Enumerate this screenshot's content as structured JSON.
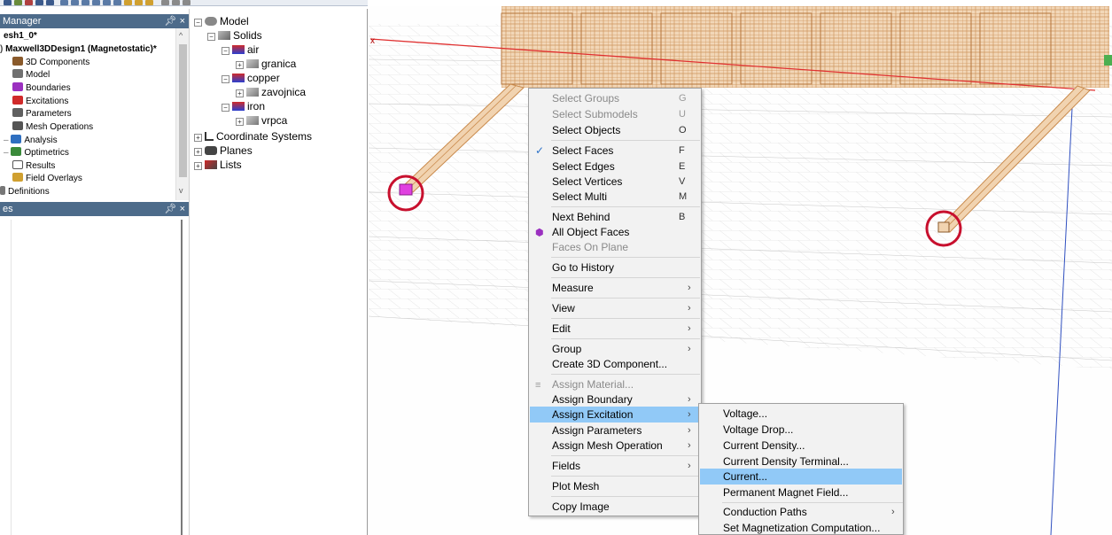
{
  "project_manager": {
    "title": "Manager",
    "items": [
      {
        "label": "esh1_0*",
        "icon": "project-icon"
      },
      {
        "label": "Maxwell3DDesign1 (Magnetostatic)*",
        "icon": "design-icon"
      },
      {
        "label": "3D Components",
        "icon": "components-icon"
      },
      {
        "label": "Model",
        "icon": "model-icon"
      },
      {
        "label": "Boundaries",
        "icon": "boundaries-icon"
      },
      {
        "label": "Excitations",
        "icon": "excitations-icon"
      },
      {
        "label": "Parameters",
        "icon": "parameters-icon"
      },
      {
        "label": "Mesh Operations",
        "icon": "mesh-icon"
      },
      {
        "label": "Analysis",
        "icon": "analysis-icon"
      },
      {
        "label": "Optimetrics",
        "icon": "optimetrics-icon"
      },
      {
        "label": "Results",
        "icon": "results-icon"
      },
      {
        "label": "Field Overlays",
        "icon": "field-overlays-icon"
      },
      {
        "label": "Definitions",
        "icon": "definitions-icon"
      }
    ]
  },
  "properties_panel": {
    "title": "es"
  },
  "model_tree": {
    "items": [
      {
        "label": "Model",
        "icon": "model-icon"
      },
      {
        "label": "Solids",
        "icon": "solids-icon"
      },
      {
        "label": "air",
        "icon": "material-icon"
      },
      {
        "label": "granica",
        "icon": "object-icon"
      },
      {
        "label": "copper",
        "icon": "material-icon"
      },
      {
        "label": "zavojnica",
        "icon": "object-icon"
      },
      {
        "label": "iron",
        "icon": "material-icon"
      },
      {
        "label": "vrpca",
        "icon": "object-icon"
      },
      {
        "label": "Coordinate Systems",
        "icon": "coordinate-icon"
      },
      {
        "label": "Planes",
        "icon": "planes-icon"
      },
      {
        "label": "Lists",
        "icon": "lists-icon"
      }
    ]
  },
  "viewport": {
    "axis_label": "x"
  },
  "context_menu": {
    "items": [
      {
        "label": "Select Groups",
        "key": "G"
      },
      {
        "label": "Select Submodels",
        "key": "U"
      },
      {
        "label": "Select Objects",
        "key": "O"
      },
      {
        "label": "Select Faces",
        "key": "F"
      },
      {
        "label": "Select Edges",
        "key": "E"
      },
      {
        "label": "Select Vertices",
        "key": "V"
      },
      {
        "label": "Select Multi",
        "key": "M"
      },
      {
        "label": "Next Behind",
        "key": "B"
      },
      {
        "label": "All Object Faces"
      },
      {
        "label": "Faces On Plane"
      },
      {
        "label": "Go to History"
      },
      {
        "label": "Measure"
      },
      {
        "label": "View"
      },
      {
        "label": "Edit"
      },
      {
        "label": "Group"
      },
      {
        "label": "Create 3D Component..."
      },
      {
        "label": "Assign Material..."
      },
      {
        "label": "Assign Boundary"
      },
      {
        "label": "Assign Excitation"
      },
      {
        "label": "Assign Parameters"
      },
      {
        "label": "Assign Mesh Operation"
      },
      {
        "label": "Fields"
      },
      {
        "label": "Plot Mesh"
      },
      {
        "label": "Copy Image"
      }
    ]
  },
  "submenu": {
    "items": [
      {
        "label": "Voltage..."
      },
      {
        "label": "Voltage Drop..."
      },
      {
        "label": "Current Density..."
      },
      {
        "label": "Current Density Terminal..."
      },
      {
        "label": "Current..."
      },
      {
        "label": "Permanent Magnet Field..."
      },
      {
        "label": "Conduction Paths"
      },
      {
        "label": "Set Magnetization Computation..."
      }
    ]
  },
  "colors": {
    "panel_header": "#4d6b8a",
    "menu_highlight": "#91c9f7",
    "selection_circle": "#c8102e",
    "coil": "#d9a066",
    "selected_face": "#e040e0"
  }
}
